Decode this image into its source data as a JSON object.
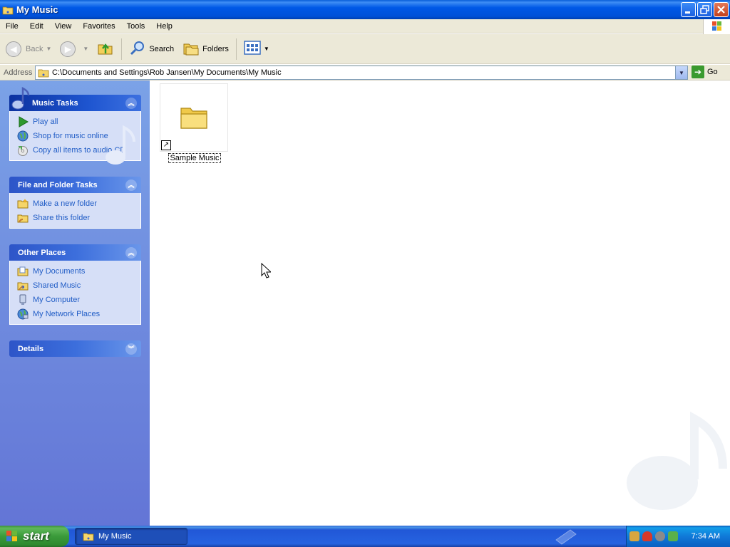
{
  "window": {
    "title": "My Music"
  },
  "menu": [
    "File",
    "Edit",
    "View",
    "Favorites",
    "Tools",
    "Help"
  ],
  "toolbar": {
    "back_label": "Back",
    "search_label": "Search",
    "folders_label": "Folders"
  },
  "address": {
    "label": "Address",
    "value": "C:\\Documents and Settings\\Rob Jansen\\My Documents\\My Music",
    "go_label": "Go"
  },
  "panels": {
    "music_tasks": {
      "title": "Music Tasks",
      "items": [
        "Play all",
        "Shop for music online",
        "Copy all items to audio CD"
      ]
    },
    "file_folder_tasks": {
      "title": "File and Folder Tasks",
      "items": [
        "Make a new folder",
        "Share this folder"
      ]
    },
    "other_places": {
      "title": "Other Places",
      "items": [
        "My Documents",
        "Shared Music",
        "My Computer",
        "My Network Places"
      ]
    },
    "details": {
      "title": "Details"
    }
  },
  "content": {
    "items": [
      {
        "label": "Sample Music"
      }
    ]
  },
  "taskbar": {
    "start_label": "start",
    "task_label": "My Music",
    "clock": "7:34 AM"
  }
}
